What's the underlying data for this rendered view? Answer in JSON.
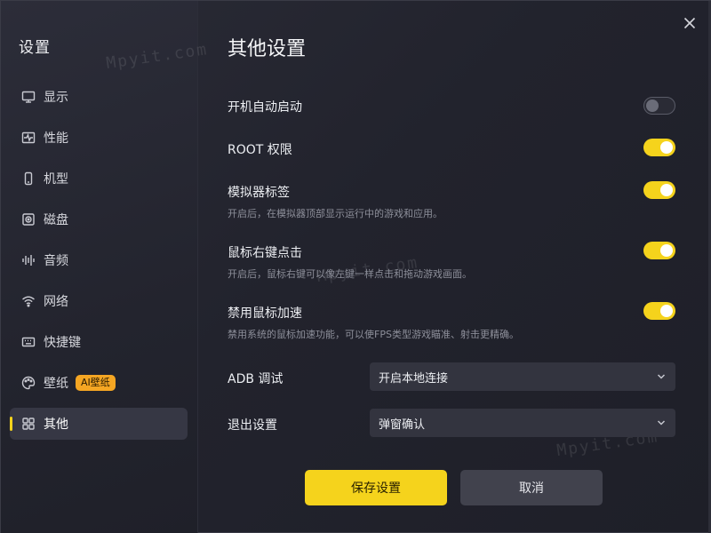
{
  "sidebar": {
    "title": "设置",
    "items": [
      {
        "label": "显示",
        "icon": "monitor-icon"
      },
      {
        "label": "性能",
        "icon": "pulse-icon"
      },
      {
        "label": "机型",
        "icon": "phone-icon"
      },
      {
        "label": "磁盘",
        "icon": "disk-icon"
      },
      {
        "label": "音频",
        "icon": "audio-wave-icon"
      },
      {
        "label": "网络",
        "icon": "wifi-icon"
      },
      {
        "label": "快捷键",
        "icon": "keyboard-icon"
      },
      {
        "label": "壁纸",
        "icon": "palette-icon",
        "badge": "AI壁纸"
      },
      {
        "label": "其他",
        "icon": "grid-icon",
        "active": true
      }
    ]
  },
  "watermarks": [
    "Mpyit.com",
    "Mpyit.com",
    "Mpyit.com"
  ],
  "main": {
    "title": "其他设置",
    "settings": [
      {
        "label": "开机自动启动",
        "desc": "",
        "enabled": false
      },
      {
        "label": "ROOT 权限",
        "desc": "",
        "enabled": true
      },
      {
        "label": "模拟器标签",
        "desc": "开启后，在模拟器顶部显示运行中的游戏和应用。",
        "enabled": true
      },
      {
        "label": "鼠标右键点击",
        "desc": "开启后，鼠标右键可以像左键一样点击和拖动游戏画面。",
        "enabled": true
      },
      {
        "label": "禁用鼠标加速",
        "desc": "禁用系统的鼠标加速功能，可以使FPS类型游戏瞄准、射击更精确。",
        "enabled": true
      }
    ],
    "adb": {
      "label": "ADB 调试",
      "value": "开启本地连接"
    },
    "exit": {
      "label": "退出设置",
      "value": "弹窗确认"
    }
  },
  "buttons": {
    "save": "保存设置",
    "cancel": "取消"
  },
  "colors": {
    "accent": "#f5d31c",
    "badge": "#f5a623",
    "background": "#1f2029"
  }
}
